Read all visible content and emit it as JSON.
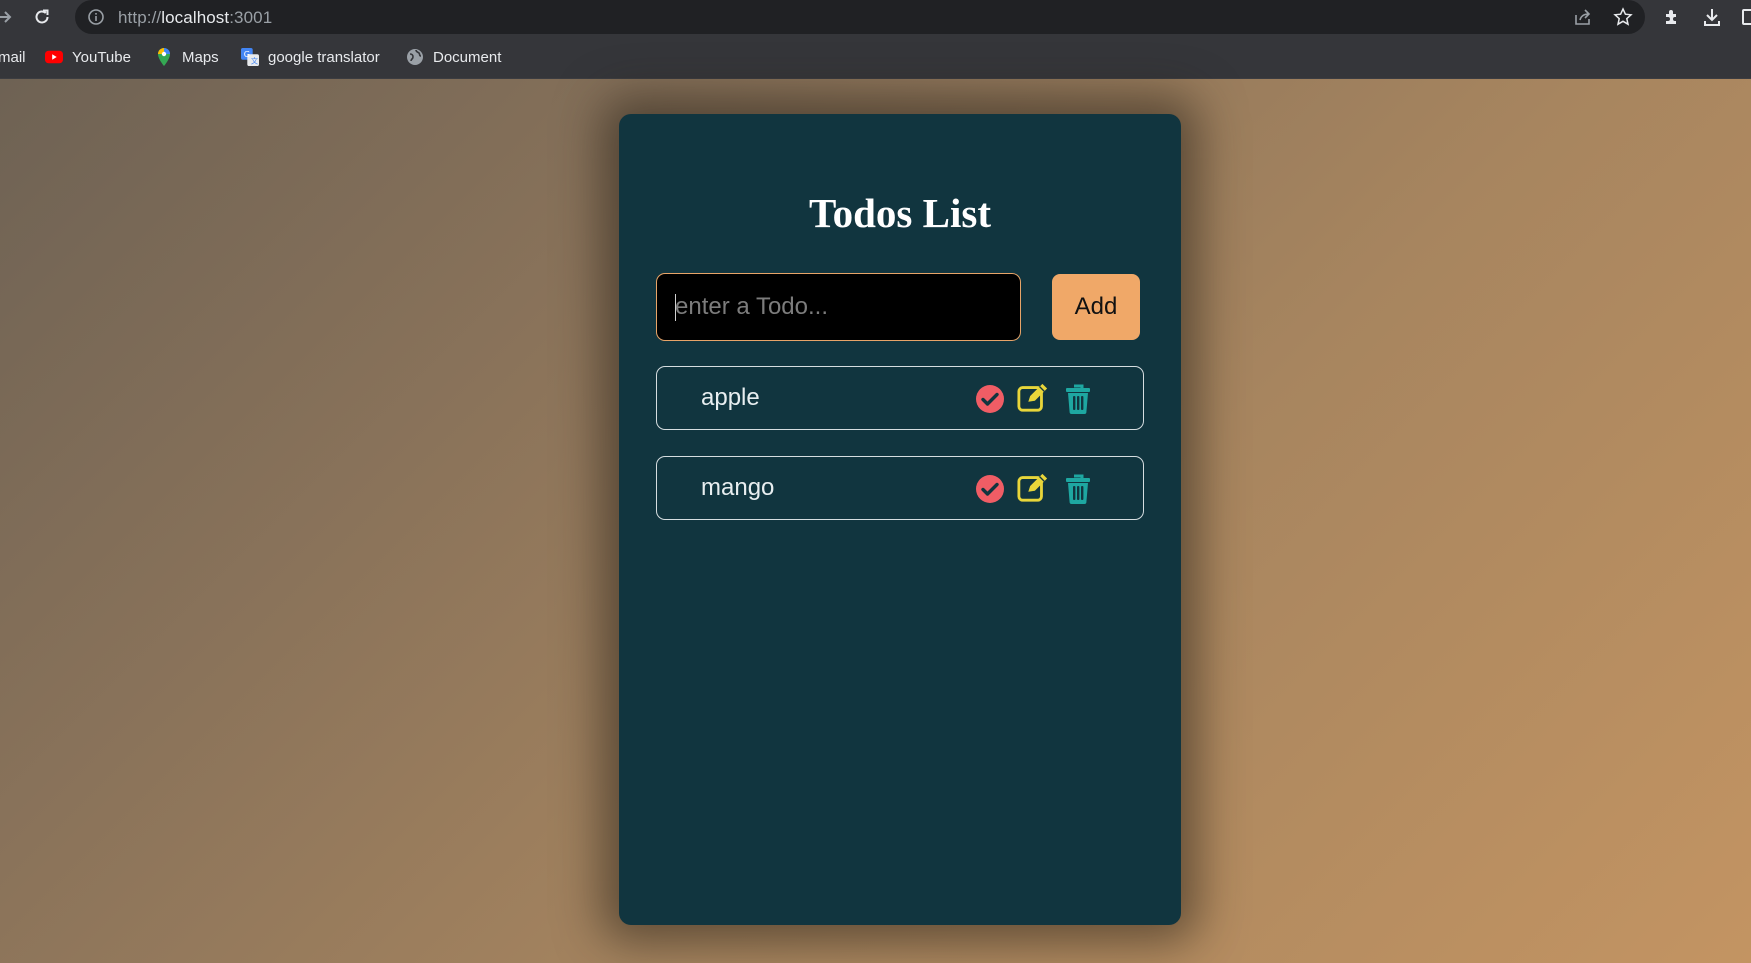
{
  "browser": {
    "url_scheme": "http://",
    "url_host": "localhost",
    "url_port": ":3001",
    "bookmarks": [
      {
        "label": "mail",
        "icon": "gmail-icon"
      },
      {
        "label": "YouTube",
        "icon": "youtube-icon"
      },
      {
        "label": "Maps",
        "icon": "maps-icon"
      },
      {
        "label": "google translator",
        "icon": "google-translate-icon"
      },
      {
        "label": "Document",
        "icon": "globe-icon"
      }
    ]
  },
  "app": {
    "title": "Todos List",
    "input": {
      "value": "",
      "placeholder": "enter a Todo..."
    },
    "add_label": "Add",
    "todos": [
      {
        "text": "apple"
      },
      {
        "text": "mango"
      }
    ]
  },
  "colors": {
    "card_background": "#11353f",
    "add_button": "#f0a868",
    "complete_icon": "#f05d65",
    "edit_icon": "#e8d63a",
    "delete_icon": "#1ea7a1"
  }
}
